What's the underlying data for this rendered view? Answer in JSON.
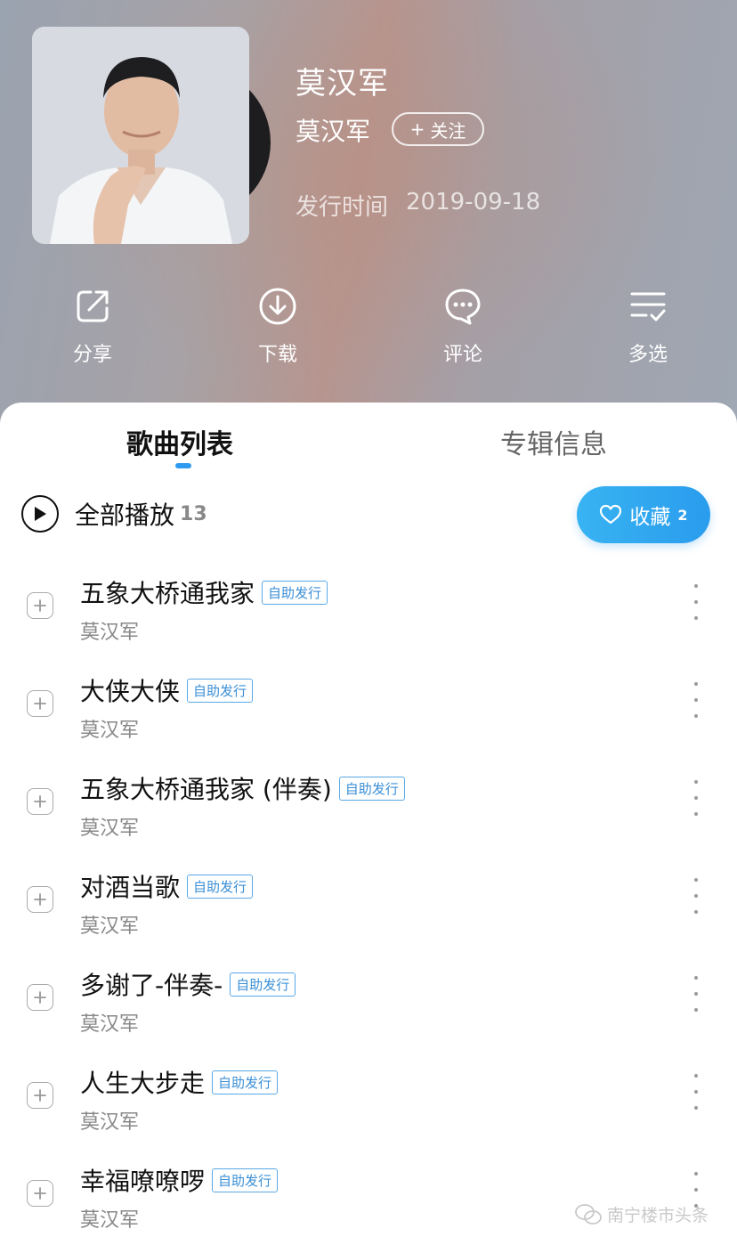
{
  "album": {
    "title": "莫汉军",
    "artist": "莫汉军",
    "follow_label": "关注",
    "release_label": "发行时间",
    "release_date": "2019-09-18"
  },
  "actions": [
    {
      "label": "分享",
      "icon": "share-icon"
    },
    {
      "label": "下载",
      "icon": "download-icon"
    },
    {
      "label": "评论",
      "icon": "comment-icon"
    },
    {
      "label": "多选",
      "icon": "multi-select-icon"
    }
  ],
  "tabs": {
    "songs_label": "歌曲列表",
    "info_label": "专辑信息",
    "active": "songs"
  },
  "playall": {
    "label": "全部播放",
    "count": "13"
  },
  "collect": {
    "label": "收藏",
    "count": "2"
  },
  "songs": [
    {
      "title": "五象大桥通我家",
      "badge": "自助发行",
      "artist": "莫汉军"
    },
    {
      "title": "大侠大侠",
      "badge": "自助发行",
      "artist": "莫汉军"
    },
    {
      "title": "五象大桥通我家 (伴奏)",
      "badge": "自助发行",
      "artist": "莫汉军"
    },
    {
      "title": "对酒当歌",
      "badge": "自助发行",
      "artist": "莫汉军"
    },
    {
      "title": "多谢了-伴奏-",
      "badge": "自助发行",
      "artist": "莫汉军"
    },
    {
      "title": "人生大步走",
      "badge": "自助发行",
      "artist": "莫汉军"
    },
    {
      "title": "幸福嘹嘹啰",
      "badge": "自助发行",
      "artist": "莫汉军"
    }
  ],
  "watermark": {
    "text": "南宁楼市头条"
  },
  "colors": {
    "accent": "#2f9bf0",
    "badge": "#3b8fd6"
  }
}
